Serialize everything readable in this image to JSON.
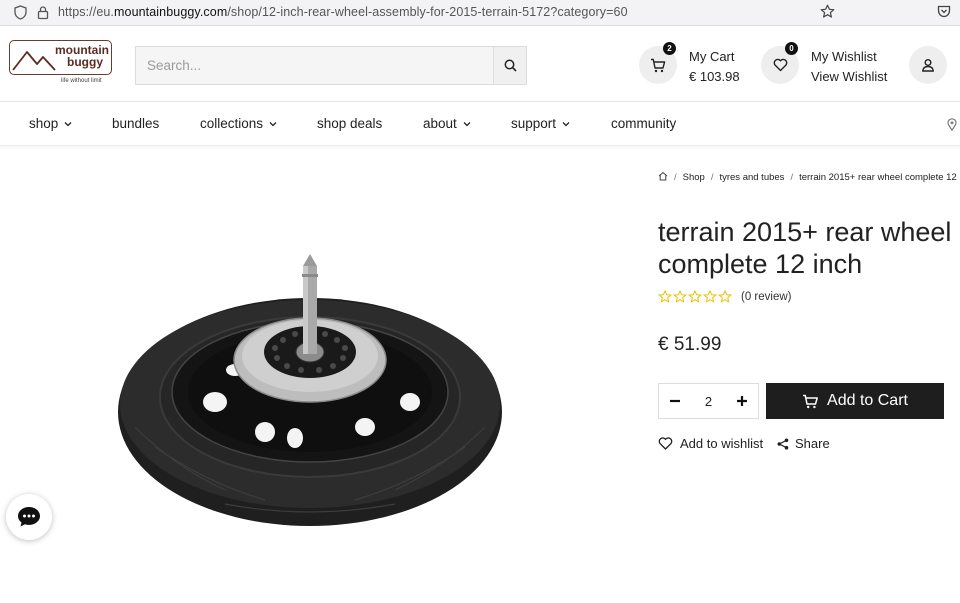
{
  "browser": {
    "url_prefix": "https://eu.",
    "url_domain": "mountainbuggy.com",
    "url_path": "/shop/12-inch-rear-wheel-assembly-for-2015-terrain-5172?category=60"
  },
  "header": {
    "logo_line1": "mountain",
    "logo_line2": "buggy",
    "logo_tagline": "life without limit",
    "search_placeholder": "Search...",
    "cart_count": "2",
    "cart_label": "My Cart",
    "cart_total": "€ 103.98",
    "wishlist_count": "0",
    "wishlist_label": "My Wishlist",
    "wishlist_link": "View Wishlist"
  },
  "nav": {
    "items": [
      {
        "label": "shop"
      },
      {
        "label": "bundles"
      },
      {
        "label": "collections"
      },
      {
        "label": "shop deals"
      },
      {
        "label": "about"
      },
      {
        "label": "support"
      },
      {
        "label": "community"
      }
    ]
  },
  "breadcrumb": {
    "shop": "Shop",
    "category": "tyres and tubes",
    "current": "terrain 2015+ rear wheel complete 12"
  },
  "product": {
    "title": "terrain 2015+ rear wheel complete 12 inch",
    "rating": 0,
    "review_count": "(0 review)",
    "price": "€ 51.99",
    "quantity": "2",
    "add_to_cart": "Add to Cart",
    "add_to_wishlist": "Add to wishlist",
    "share": "Share"
  },
  "colors": {
    "brand": "#5a2d22",
    "button_dark": "#1e1e1e",
    "star": "#e8c200"
  }
}
